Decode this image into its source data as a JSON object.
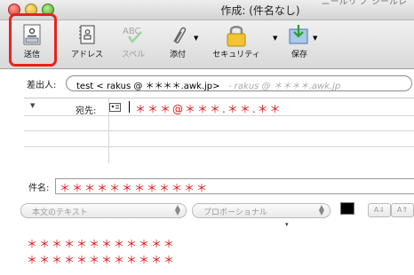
{
  "window": {
    "title": "作成: (件名なし)",
    "behind_text": "ニールリ ノ シールレ"
  },
  "toolbar": {
    "send": "送信",
    "address": "アドレス",
    "spelling": "スペル",
    "spelling_icon_text": "ABC",
    "attach": "添付",
    "security": "セキュリティ",
    "save": "保存"
  },
  "from": {
    "label": "差出人:",
    "value": "test < rakus @ ＊＊＊＊.awk.jp>",
    "alt": "- rakus @ ＊＊＊＊.awk.jp"
  },
  "to": {
    "label": "宛先:",
    "value": "＊＊＊@＊＊＊.＊＊.＊＊"
  },
  "subject": {
    "label": "件名:",
    "value": "＊＊＊＊＊＊＊＊＊＊＊＊"
  },
  "format": {
    "style": "本文のテキスト",
    "font": "プロポーショナル",
    "size_down": "A⇓",
    "size_up": "A⇑"
  },
  "body": {
    "line1": "＊＊＊＊＊＊＊＊＊＊＊＊",
    "line2": "＊＊＊＊＊＊＊＊＊＊＊＊"
  },
  "colors": {
    "highlight": "#e8231c",
    "redacted_text": "#e01010"
  },
  "icons": [
    "send-icon",
    "address-book-icon",
    "spelling-icon",
    "paperclip-icon",
    "lock-icon",
    "save-icon",
    "address-card-icon"
  ]
}
